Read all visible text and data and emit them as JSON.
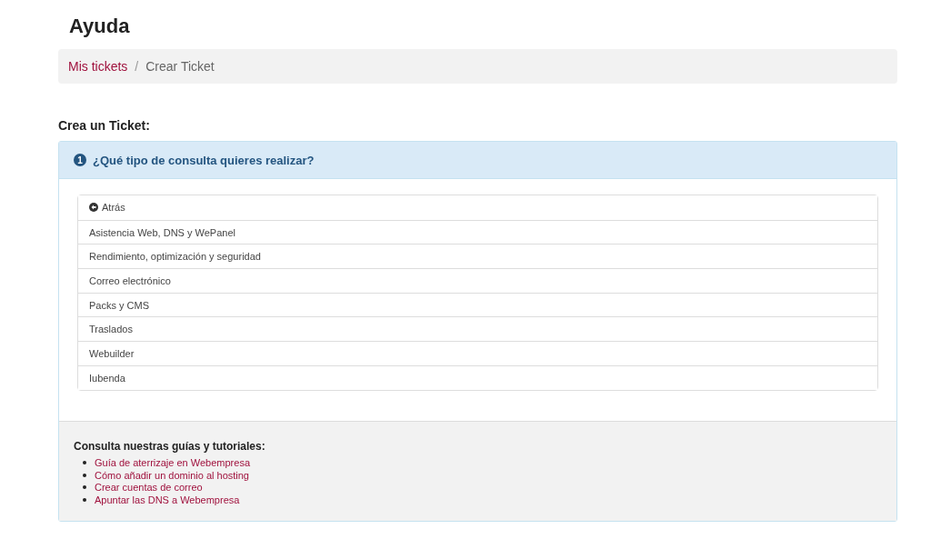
{
  "page_title": "Ayuda",
  "breadcrumb": [
    {
      "label": "Mis tickets",
      "kind": "link"
    },
    {
      "label": "/",
      "kind": "separator"
    },
    {
      "label": "Crear Ticket",
      "kind": "current"
    }
  ],
  "section_title": "Crea un Ticket:",
  "panel": {
    "step": "1",
    "title": "¿Qué tipo de consulta quieres realizar?",
    "options": [
      {
        "label": "Atrás",
        "kind": "back"
      },
      {
        "label": "Asistencia Web, DNS y WePanel",
        "kind": "option"
      },
      {
        "label": "Rendimiento, optimización y seguridad",
        "kind": "option"
      },
      {
        "label": "Correo electrónico",
        "kind": "option"
      },
      {
        "label": "Packs y CMS",
        "kind": "option"
      },
      {
        "label": "Traslados",
        "kind": "option"
      },
      {
        "label": "Webuilder",
        "kind": "option"
      },
      {
        "label": "Iubenda",
        "kind": "option"
      }
    ],
    "guides_title": "Consulta nuestras guías y tutoriales:",
    "guides": [
      "Guía de aterrizaje en Webempresa",
      "Cómo añadir un dominio al hosting",
      "Crear cuentas de correo",
      "Apuntar las DNS a Webempresa"
    ]
  }
}
